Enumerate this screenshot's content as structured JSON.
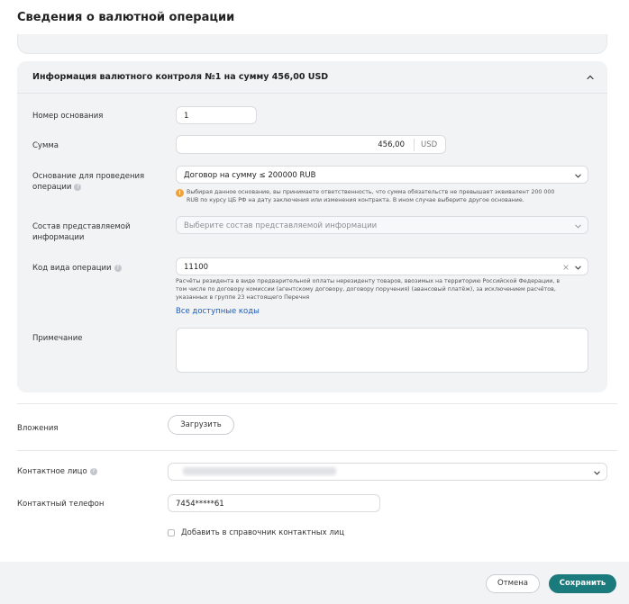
{
  "page": {
    "title": "Сведения о валютной операции"
  },
  "card": {
    "title": "Информация валютного контроля №1 на сумму 456,00 USD",
    "fields": {
      "base_number_label": "Номер основания",
      "base_number_value": "1",
      "amount_label": "Сумма",
      "amount_value": "456,00",
      "amount_currency": "USD",
      "basis_label_line1": "Основание для проведения",
      "basis_label_line2": "операции",
      "basis_value": "Договор на сумму ≤ 200000 RUB",
      "basis_warning_line1": "Выбирая данное основание, вы принимаете ответственность, что сумма обязательств не превышает эквивалент 200 000",
      "basis_warning_line2": "RUB по курсу ЦБ РФ на дату заключения или изменения контракта. В ином случае выберите другое основание.",
      "composition_label_line1": "Состав представляемой",
      "composition_label_line2": "информации",
      "composition_placeholder": "Выберите состав представляемой информации",
      "op_code_label": "Код вида операции",
      "op_code_value": "11100",
      "op_code_desc_line1": "Расчёты резидента в виде предварительной оплаты нерезиденту товаров, ввозимых на территорию Российской Федерации, в",
      "op_code_desc_line2": "том числе по договору комиссии (агентскому договору, договору поручения) (авансовый платёж), за исключением расчётов,",
      "op_code_desc_line3": "указанных в группе 23 настоящего Перечня",
      "all_codes_link": "Все доступные коды",
      "note_label": "Примечание",
      "note_value": ""
    }
  },
  "attachments": {
    "label": "Вложения",
    "upload_button": "Загрузить"
  },
  "contact": {
    "person_label": "Контактное лицо",
    "phone_label": "Контактный телефон",
    "phone_value": "7454*****61",
    "add_to_directory": "Добавить в справочник контактных лиц"
  },
  "footer": {
    "cancel": "Отмена",
    "save": "Сохранить"
  },
  "icons": {
    "hint": "?",
    "warning": "!"
  }
}
